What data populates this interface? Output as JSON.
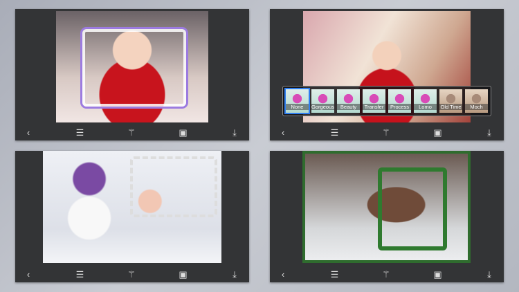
{
  "toolbar": {
    "back": "‹",
    "list": "☰",
    "magic": "⚚",
    "image": "▣",
    "download": "⤓"
  },
  "filters": [
    "None",
    "Gorgeous",
    "Beauty",
    "Transfer",
    "Process",
    "Lomo",
    "Old Time",
    "Moch"
  ],
  "colors": {
    "panel": "#333436",
    "selected": "#2f7ef0"
  }
}
